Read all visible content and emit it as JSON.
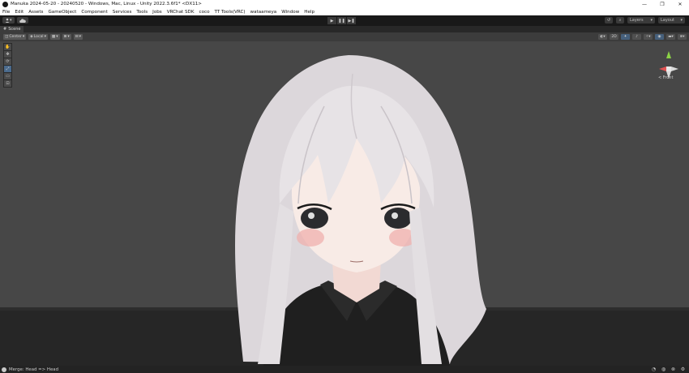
{
  "window": {
    "title": "Manuka 2024-05-20 - 20240520 - Windows, Mac, Linux - Unity 2022.3.6f1* <DX11>",
    "minimize": "—",
    "maximize": "❐",
    "close": "✕"
  },
  "menu": [
    "File",
    "Edit",
    "Assets",
    "GameObject",
    "Component",
    "Services",
    "Tools",
    "Jobs",
    "VRChat SDK",
    "coco",
    "TT Tools(VRC)",
    "wataameya",
    "Window",
    "Help"
  ],
  "toolbar": {
    "account_label": "▾",
    "play": "▶",
    "pause": "❚❚",
    "step": "▶❚",
    "history_icon": "↺",
    "search_icon": "⌕",
    "layers": "Layers",
    "layout": "Layout"
  },
  "scene": {
    "tab_label": "Scene",
    "pivot": "Center",
    "space": "Local",
    "gizmo_label": "< Front"
  },
  "tools": [
    "✋",
    "✥",
    "⟳",
    "⤢",
    "▭",
    "⊡"
  ],
  "status": {
    "message": "Merge: Head => Head"
  },
  "colors": {
    "viewport_bg": "#474747",
    "floor": "#262626",
    "hair": "#e7e3e6",
    "skin": "#f8ebe6",
    "shirt": "#1f1f1f"
  }
}
